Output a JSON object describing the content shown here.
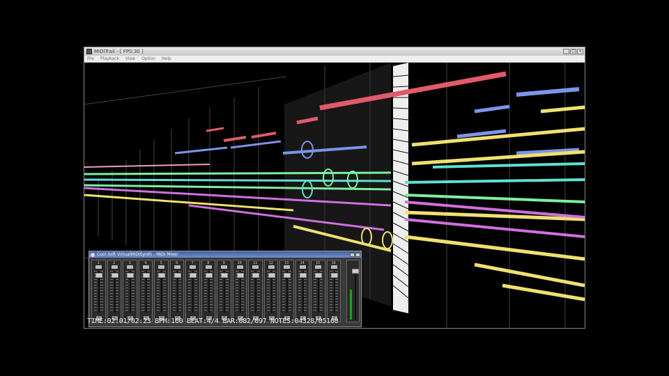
{
  "window": {
    "title": "MIDITrail - [ FPS:30 ]",
    "controls": [
      "_",
      "□",
      "×"
    ]
  },
  "menu": [
    "File",
    "Playback",
    "View",
    "Option",
    "Help"
  ],
  "mixer": {
    "title": "Cool Soft VirtualMIDISynth - MIDI Mixer",
    "channels": [
      "1",
      "2",
      "3",
      "4",
      "5",
      "6",
      "7",
      "8",
      "9",
      "10",
      "11",
      "12",
      "13",
      "14",
      "15",
      "16"
    ],
    "channel_button": "E",
    "fader_levels": [
      0.95,
      0.95,
      0.95,
      0.95,
      0.95,
      0.95,
      0.95,
      0.95,
      0.95,
      0.95,
      0.95,
      0.95,
      0.95,
      0.95,
      0.95,
      0.95
    ],
    "master_level": 0.62
  },
  "status": {
    "text": "TIME:02:01/02:23 BPM:160 BEAT:4/4 BAR:082/097 NOTES:04328/05160"
  },
  "colors": {
    "red": "#e05a6a",
    "blue": "#7a95e8",
    "yellow": "#f0e070",
    "green": "#7ef0a0",
    "cyan": "#60e0d0",
    "magenta": "#d070e0",
    "pink": "#f0a0b0"
  }
}
